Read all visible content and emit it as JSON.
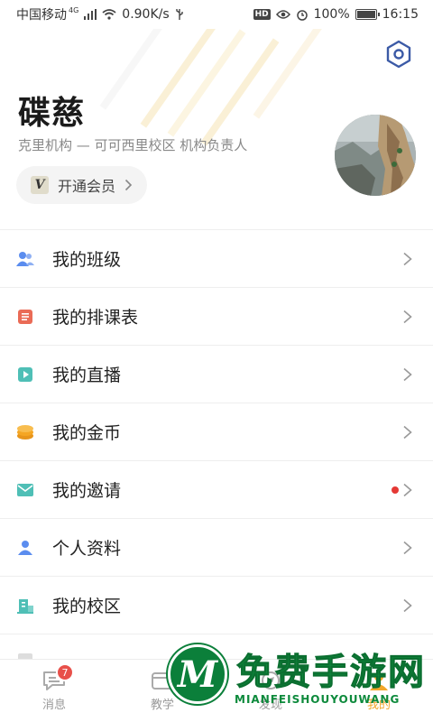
{
  "status_bar": {
    "carrier": "中国移动",
    "network": "4G",
    "speed": "0.90K/s",
    "battery_percent": "100%",
    "time": "16:15",
    "hd_label": "HD"
  },
  "profile": {
    "name": "碟慈",
    "subtitle": "克里机构 — 可可西里校区 机构负责人",
    "vip_badge": "V",
    "vip_label": "开通会员"
  },
  "menu": {
    "items": [
      {
        "label": "我的班级",
        "icon": "class-icon",
        "color": "#5b8def"
      },
      {
        "label": "我的排课表",
        "icon": "schedule-icon",
        "color": "#ea6b56"
      },
      {
        "label": "我的直播",
        "icon": "live-icon",
        "color": "#4fbfb6"
      },
      {
        "label": "我的金币",
        "icon": "coin-icon",
        "color": "#f5a623"
      },
      {
        "label": "我的邀请",
        "icon": "mail-icon",
        "color": "#4fbfb6",
        "has_dot": true
      },
      {
        "label": "个人资料",
        "icon": "person-icon",
        "color": "#5b8def"
      },
      {
        "label": "我的校区",
        "icon": "campus-icon",
        "color": "#4fbfb6"
      },
      {
        "label": "",
        "icon": "partial-icon",
        "color": "#cccccc"
      }
    ]
  },
  "tabs": {
    "items": [
      {
        "label": "消息",
        "icon": "message-icon",
        "badge": "7"
      },
      {
        "label": "教学",
        "icon": "teaching-icon"
      },
      {
        "label": "发现",
        "icon": "discover-icon"
      },
      {
        "label": "我的",
        "icon": "profile-icon"
      }
    ]
  },
  "watermark": {
    "title": "免费手游网",
    "subtitle": "MIANFEISHOUYOUWANG"
  },
  "colors": {
    "accent": "#5b8def",
    "badge_red": "#e8504a",
    "watermark_green": "#0d8a3c"
  }
}
